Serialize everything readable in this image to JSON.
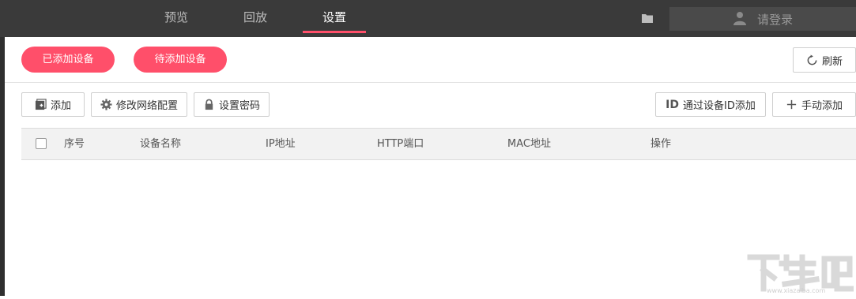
{
  "topnav": {
    "items": [
      {
        "label": "预览"
      },
      {
        "label": "回放"
      },
      {
        "label": "设置"
      }
    ],
    "active_index": 2,
    "login_placeholder": "请登录"
  },
  "device_tabs": {
    "added": "已添加设备",
    "pending": "待添加设备"
  },
  "refresh_label": "刷新",
  "toolbar": {
    "add": "添加",
    "network_config": "修改网络配置",
    "set_password": "设置密码",
    "add_by_id": "通过设备ID添加",
    "manual_add": "手动添加"
  },
  "table": {
    "columns": [
      "序号",
      "设备名称",
      "IP地址",
      "HTTP端口",
      "MAC地址",
      "操作"
    ],
    "rows": []
  },
  "watermark": {
    "text": "下载吧",
    "url": "www.xiazaiba.com"
  },
  "colors": {
    "accent": "#ff4f6a",
    "topbar": "#3a3a3a"
  }
}
